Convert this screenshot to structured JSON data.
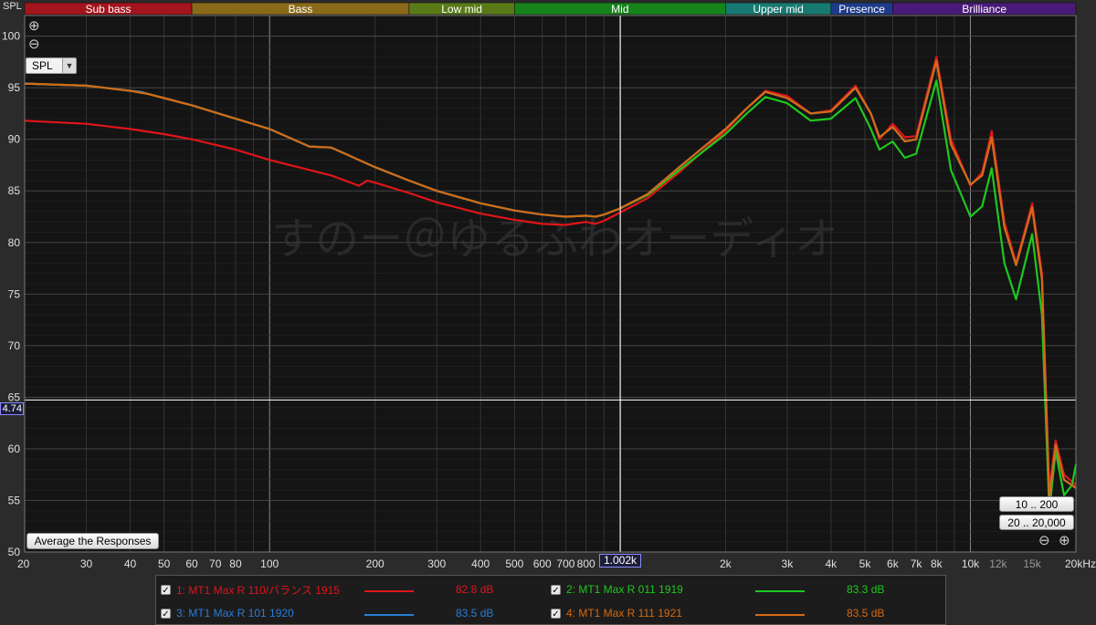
{
  "chart_data": {
    "type": "line",
    "ylabel": "SPL",
    "xlabel": "",
    "x_unit_suffix": "kHz",
    "ylim": [
      50,
      102
    ],
    "xlim": [
      20,
      20000
    ],
    "x_scale": "log",
    "y_ticks": [
      50,
      55,
      60,
      65,
      70,
      75,
      80,
      85,
      90,
      95,
      100
    ],
    "x_ticks": [
      {
        "v": 20,
        "label": "20"
      },
      {
        "v": 30,
        "label": "30"
      },
      {
        "v": 40,
        "label": "40"
      },
      {
        "v": 50,
        "label": "50"
      },
      {
        "v": 60,
        "label": "60"
      },
      {
        "v": 70,
        "label": "70"
      },
      {
        "v": 80,
        "label": "80"
      },
      {
        "v": 100,
        "label": "100"
      },
      {
        "v": 200,
        "label": "200"
      },
      {
        "v": 300,
        "label": "300"
      },
      {
        "v": 400,
        "label": "400"
      },
      {
        "v": 500,
        "label": "500"
      },
      {
        "v": 600,
        "label": "600"
      },
      {
        "v": 700,
        "label": "700"
      },
      {
        "v": 800,
        "label": "800"
      },
      {
        "v": 2000,
        "label": "2k"
      },
      {
        "v": 3000,
        "label": "3k"
      },
      {
        "v": 4000,
        "label": "4k"
      },
      {
        "v": 5000,
        "label": "5k"
      },
      {
        "v": 6000,
        "label": "6k"
      },
      {
        "v": 7000,
        "label": "7k"
      },
      {
        "v": 8000,
        "label": "8k"
      },
      {
        "v": 10000,
        "label": "10k"
      },
      {
        "v": 12000,
        "label": "12k",
        "dim": true
      },
      {
        "v": 15000,
        "label": "15k",
        "dim": true
      },
      {
        "v": 20000,
        "label": "20kHz"
      }
    ],
    "bands": [
      {
        "name": "Sub bass",
        "from": 20,
        "to": 60,
        "color": "#a3141c"
      },
      {
        "name": "Bass",
        "from": 60,
        "to": 250,
        "color": "#8a6a18"
      },
      {
        "name": "Low mid",
        "from": 250,
        "to": 500,
        "color": "#5a7a18"
      },
      {
        "name": "Mid",
        "from": 500,
        "to": 2000,
        "color": "#16841a"
      },
      {
        "name": "Upper mid",
        "from": 2000,
        "to": 4000,
        "color": "#177a72"
      },
      {
        "name": "Presence",
        "from": 4000,
        "to": 6000,
        "color": "#1e3a8a"
      },
      {
        "name": "Brilliance",
        "from": 6000,
        "to": 20000,
        "color": "#4a1a78"
      }
    ],
    "cursor": {
      "x": 1002,
      "x_label": "1.002k",
      "y": 64.74,
      "y_label": "4.74"
    },
    "watermark": "すのー＠ゆるふわオーディオ",
    "series": [
      {
        "name": "MT1 Max R 110/バランス 1915",
        "color": "#e0141a",
        "points": [
          [
            20,
            91.8
          ],
          [
            30,
            91.5
          ],
          [
            40,
            91.0
          ],
          [
            50,
            90.5
          ],
          [
            60,
            90.0
          ],
          [
            80,
            89.0
          ],
          [
            100,
            88.0
          ],
          [
            150,
            86.5
          ],
          [
            180,
            85.5
          ],
          [
            190,
            86.0
          ],
          [
            200,
            85.8
          ],
          [
            250,
            84.8
          ],
          [
            300,
            83.9
          ],
          [
            400,
            82.8
          ],
          [
            500,
            82.2
          ],
          [
            600,
            81.8
          ],
          [
            700,
            81.7
          ],
          [
            800,
            82.0
          ],
          [
            850,
            81.8
          ],
          [
            900,
            82.1
          ],
          [
            1000,
            82.9
          ],
          [
            1200,
            84.3
          ],
          [
            1500,
            87.0
          ],
          [
            2000,
            90.8
          ],
          [
            2300,
            93.0
          ],
          [
            2600,
            94.7
          ],
          [
            3000,
            94.2
          ],
          [
            3500,
            92.5
          ],
          [
            4000,
            92.8
          ],
          [
            4700,
            95.2
          ],
          [
            5200,
            92.5
          ],
          [
            5500,
            90.0
          ],
          [
            6000,
            91.5
          ],
          [
            6500,
            90.2
          ],
          [
            7000,
            90.3
          ],
          [
            8000,
            98.0
          ],
          [
            8800,
            90.0
          ],
          [
            10000,
            85.5
          ],
          [
            10800,
            86.8
          ],
          [
            11500,
            90.8
          ],
          [
            12500,
            82.0
          ],
          [
            13500,
            78.0
          ],
          [
            15000,
            83.8
          ],
          [
            16000,
            77.0
          ],
          [
            16800,
            56.0
          ],
          [
            17500,
            60.8
          ],
          [
            18500,
            57.5
          ],
          [
            20000,
            56.5
          ]
        ]
      },
      {
        "name": "MT1 Max R 011 1919",
        "color": "#1ec81e",
        "points": [
          [
            20,
            95.4
          ],
          [
            30,
            95.2
          ],
          [
            40,
            94.7
          ],
          [
            45,
            94.4
          ],
          [
            50,
            94.0
          ],
          [
            60,
            93.3
          ],
          [
            80,
            92.0
          ],
          [
            100,
            91.0
          ],
          [
            130,
            89.3
          ],
          [
            150,
            89.2
          ],
          [
            200,
            87.3
          ],
          [
            250,
            86.0
          ],
          [
            300,
            85.0
          ],
          [
            400,
            83.8
          ],
          [
            500,
            83.1
          ],
          [
            600,
            82.7
          ],
          [
            700,
            82.5
          ],
          [
            800,
            82.6
          ],
          [
            850,
            82.5
          ],
          [
            900,
            82.7
          ],
          [
            1000,
            83.3
          ],
          [
            1200,
            84.6
          ],
          [
            1500,
            87.2
          ],
          [
            2000,
            90.5
          ],
          [
            2300,
            92.5
          ],
          [
            2600,
            94.1
          ],
          [
            3000,
            93.5
          ],
          [
            3500,
            91.8
          ],
          [
            4000,
            92.0
          ],
          [
            4700,
            94.0
          ],
          [
            5200,
            91.0
          ],
          [
            5500,
            89.0
          ],
          [
            6000,
            89.8
          ],
          [
            6500,
            88.2
          ],
          [
            7000,
            88.6
          ],
          [
            8000,
            95.7
          ],
          [
            8800,
            87.0
          ],
          [
            10000,
            82.5
          ],
          [
            10800,
            83.5
          ],
          [
            11500,
            87.2
          ],
          [
            12500,
            78.0
          ],
          [
            13500,
            74.5
          ],
          [
            15000,
            80.8
          ],
          [
            16000,
            73.0
          ],
          [
            16800,
            54.0
          ],
          [
            17500,
            59.8
          ],
          [
            18500,
            55.5
          ],
          [
            19500,
            56.5
          ],
          [
            20000,
            58.5
          ]
        ]
      },
      {
        "name": "MT1 Max R 101 1920",
        "color": "#2a7cd8",
        "points": [
          [
            20,
            95.4
          ],
          [
            30,
            95.2
          ],
          [
            40,
            94.7
          ],
          [
            43,
            94.6
          ],
          [
            45,
            94.4
          ],
          [
            50,
            94.0
          ],
          [
            60,
            93.3
          ],
          [
            80,
            92.0
          ],
          [
            100,
            91.0
          ],
          [
            130,
            89.3
          ],
          [
            150,
            89.2
          ],
          [
            200,
            87.3
          ],
          [
            250,
            86.0
          ],
          [
            300,
            85.0
          ],
          [
            400,
            83.8
          ],
          [
            500,
            83.1
          ],
          [
            600,
            82.7
          ],
          [
            700,
            82.5
          ],
          [
            800,
            82.6
          ],
          [
            850,
            82.5
          ],
          [
            900,
            82.7
          ],
          [
            1000,
            83.3
          ],
          [
            1200,
            84.7
          ],
          [
            1500,
            87.5
          ],
          [
            2000,
            91.0
          ],
          [
            2300,
            93.0
          ],
          [
            2600,
            94.6
          ],
          [
            3000,
            94.0
          ],
          [
            3500,
            92.5
          ],
          [
            4000,
            92.7
          ],
          [
            4700,
            95.0
          ],
          [
            5200,
            92.5
          ],
          [
            5500,
            90.2
          ],
          [
            6000,
            91.2
          ],
          [
            6500,
            89.8
          ],
          [
            7000,
            90.0
          ],
          [
            8000,
            97.6
          ],
          [
            8800,
            89.5
          ],
          [
            10000,
            85.6
          ],
          [
            10800,
            86.5
          ],
          [
            11500,
            90.2
          ],
          [
            12500,
            81.5
          ],
          [
            13500,
            77.8
          ],
          [
            15000,
            83.4
          ],
          [
            16000,
            76.5
          ],
          [
            16800,
            55.2
          ],
          [
            17500,
            60.4
          ],
          [
            18500,
            57.0
          ],
          [
            20000,
            56.2
          ]
        ]
      },
      {
        "name": "MT1 Max R 111 1921",
        "color": "#d56a12",
        "points": [
          [
            20,
            95.4
          ],
          [
            30,
            95.2
          ],
          [
            40,
            94.7
          ],
          [
            45,
            94.4
          ],
          [
            50,
            94.0
          ],
          [
            60,
            93.3
          ],
          [
            80,
            92.0
          ],
          [
            100,
            91.0
          ],
          [
            130,
            89.3
          ],
          [
            150,
            89.2
          ],
          [
            200,
            87.3
          ],
          [
            250,
            86.0
          ],
          [
            300,
            85.0
          ],
          [
            400,
            83.8
          ],
          [
            500,
            83.1
          ],
          [
            600,
            82.7
          ],
          [
            700,
            82.5
          ],
          [
            800,
            82.6
          ],
          [
            850,
            82.5
          ],
          [
            900,
            82.7
          ],
          [
            1000,
            83.3
          ],
          [
            1200,
            84.7
          ],
          [
            1500,
            87.5
          ],
          [
            2000,
            91.0
          ],
          [
            2300,
            93.0
          ],
          [
            2600,
            94.6
          ],
          [
            3000,
            94.0
          ],
          [
            3500,
            92.5
          ],
          [
            4000,
            92.7
          ],
          [
            4700,
            95.0
          ],
          [
            5200,
            92.5
          ],
          [
            5500,
            90.2
          ],
          [
            6000,
            91.2
          ],
          [
            6500,
            89.8
          ],
          [
            7000,
            90.0
          ],
          [
            8000,
            97.6
          ],
          [
            8800,
            89.5
          ],
          [
            10000,
            85.6
          ],
          [
            10800,
            86.5
          ],
          [
            11500,
            90.2
          ],
          [
            12500,
            81.5
          ],
          [
            13500,
            77.8
          ],
          [
            15000,
            83.4
          ],
          [
            16000,
            76.5
          ],
          [
            16800,
            55.2
          ],
          [
            17500,
            60.4
          ],
          [
            18500,
            57.0
          ],
          [
            20000,
            56.2
          ]
        ]
      }
    ]
  },
  "ui": {
    "y_axis_title": "SPL",
    "dropdown_value": "SPL",
    "average_button": "Average the Responses",
    "range_buttons": [
      "10 .. 200",
      "20 .. 20,000"
    ],
    "zoom_in_icon": "zoom-in-icon",
    "zoom_out_icon": "zoom-out-icon"
  },
  "legend": [
    {
      "label": "1: MT1 Max R 110/バランス 1915",
      "level": "82.8 dB",
      "color": "#e0141a",
      "checked": true
    },
    {
      "label": "2: MT1 Max R 011 1919",
      "level": "83.3 dB",
      "color": "#1ec81e",
      "checked": true
    },
    {
      "label": "3: MT1 Max R 101 1920",
      "level": "83.5 dB",
      "color": "#2a7cd8",
      "checked": true
    },
    {
      "label": "4: MT1 Max R 111 1921",
      "level": "83.5 dB",
      "color": "#d56a12",
      "checked": true
    }
  ]
}
